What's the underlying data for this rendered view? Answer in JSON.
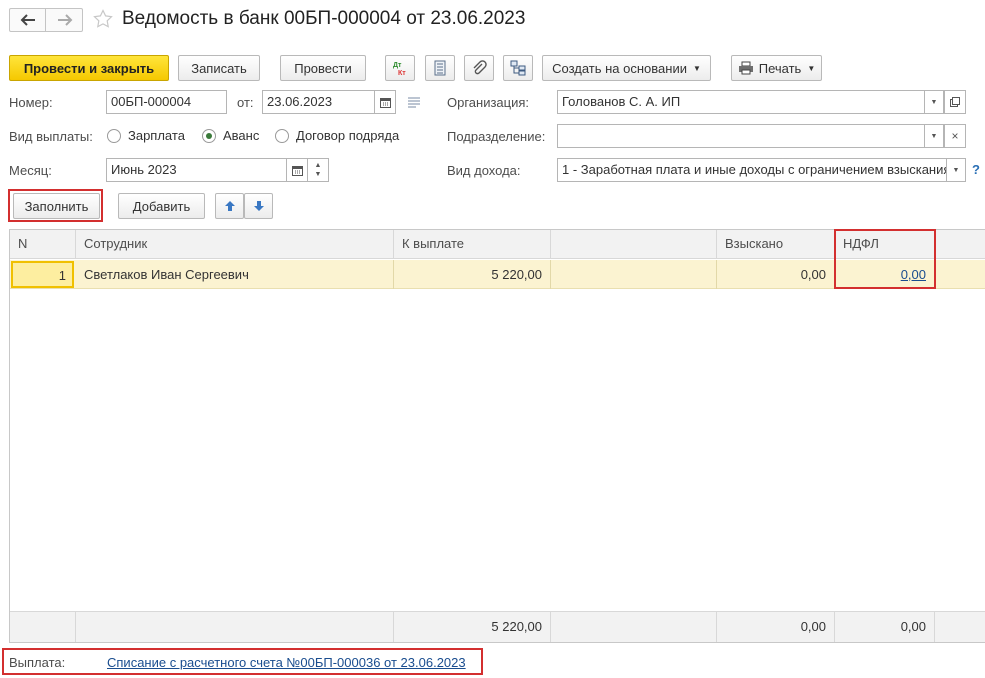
{
  "window": {
    "title": "Ведомость в банк 00БП-000004 от 23.06.2023"
  },
  "toolbar": {
    "post_close": "Провести и закрыть",
    "save": "Записать",
    "post": "Провести",
    "dtkt": "Дт Кт",
    "create_based": "Создать на основании",
    "print": "Печать"
  },
  "form": {
    "number_label": "Номер:",
    "number_value": "00БП-000004",
    "from_label": "от:",
    "date_value": "23.06.2023",
    "org_label": "Организация:",
    "org_value": "Голованов С. А. ИП",
    "payment_type_label": "Вид выплаты:",
    "payment_types": [
      "Зарплата",
      "Аванс",
      "Договор подряда"
    ],
    "payment_type_selected": "Аванс",
    "subdivision_label": "Подразделение:",
    "subdivision_value": "",
    "month_label": "Месяц:",
    "month_value": "Июнь 2023",
    "income_type_label": "Вид дохода:",
    "income_type_value": "1 - Заработная плата и иные доходы с ограничением взыскания",
    "help": "?"
  },
  "table_toolbar": {
    "fill": "Заполнить",
    "add": "Добавить"
  },
  "table": {
    "headers": [
      "N",
      "Сотрудник",
      "К выплате",
      "",
      "Взыскано",
      "НДФЛ"
    ],
    "rows": [
      {
        "n": "1",
        "employee": "Светлаков Иван Сергеевич",
        "to_pay": "5 220,00",
        "blank": "",
        "collected": "0,00",
        "ndfl": "0,00"
      }
    ],
    "totals": {
      "to_pay": "5 220,00",
      "collected": "0,00",
      "ndfl": "0,00"
    }
  },
  "footer": {
    "payment_label": "Выплата:",
    "payment_link": "Списание с расчетного счета №00БП-000036 от 23.06.2023"
  },
  "colors": {
    "accent_yellow": "#f5c800",
    "row_highlight": "#fbf3d1",
    "red_frame": "#d32f2f",
    "link": "#1a4d8f"
  }
}
